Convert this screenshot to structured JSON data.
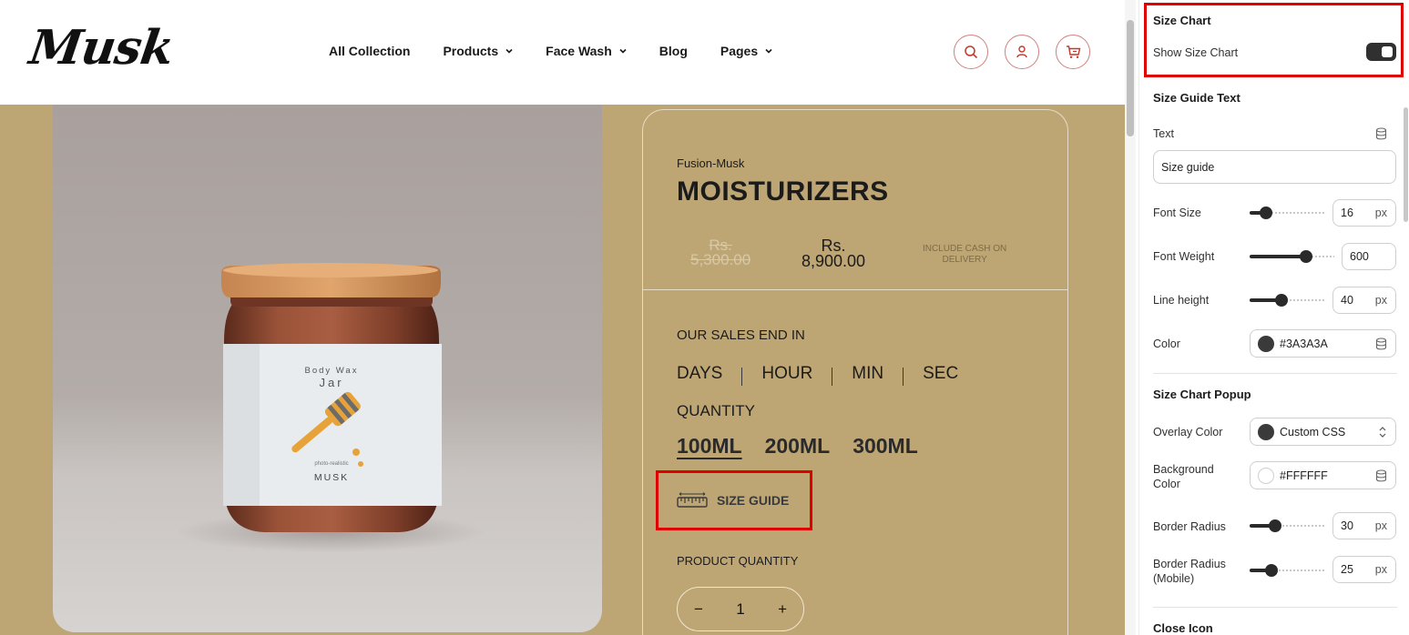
{
  "header": {
    "logo": "Musk",
    "nav": [
      {
        "label": "All Collection",
        "dropdown": false
      },
      {
        "label": "Products",
        "dropdown": true
      },
      {
        "label": "Face Wash",
        "dropdown": true
      },
      {
        "label": "Blog",
        "dropdown": false
      },
      {
        "label": "Pages",
        "dropdown": true
      }
    ],
    "icons": [
      "search-icon",
      "user-icon",
      "cart-icon"
    ],
    "icon_color": "#c0392b"
  },
  "product": {
    "image_label": {
      "line1": "Body Wax",
      "line2": "Jar",
      "line3": "photo-realistic",
      "brand": "MUSK"
    },
    "vendor": "Fusion-Musk",
    "title": "MOISTURIZERS",
    "old_price_currency": "Rs.",
    "old_price_amount": "5,300.00",
    "new_price_currency": "Rs.",
    "new_price_amount": "8,900.00",
    "cod_note_line1": "INCLUDE CASH ON",
    "cod_note_line2": "DELIVERY",
    "sales_end_label": "OUR SALES END IN",
    "countdown": [
      "DAYS",
      "HOUR",
      "MIN",
      "SEC"
    ],
    "quantity_label": "QUANTITY",
    "variants": [
      "100ML",
      "200ML",
      "300ML"
    ],
    "selected_variant": "100ML",
    "size_guide_label": "SIZE GUIDE",
    "product_quantity_label": "PRODUCT QUANTITY",
    "stepper": {
      "minus": "−",
      "value": "1",
      "plus": "+"
    },
    "background_color": "#bea674"
  },
  "panel": {
    "size_chart": {
      "heading": "Size Chart",
      "show_label": "Show Size Chart",
      "show_enabled": true
    },
    "size_guide_text": {
      "heading": "Size Guide Text",
      "text_label": "Text",
      "text_value": "Size guide",
      "font_size_label": "Font Size",
      "font_size_value": "16",
      "font_size_level": 0.22,
      "font_weight_label": "Font Weight",
      "font_weight_value": "600",
      "font_weight_level": 0.67,
      "line_height_label": "Line height",
      "line_height_value": "40",
      "line_height_level": 0.42,
      "color_label": "Color",
      "color_value": "#3A3A3A",
      "unit": "px"
    },
    "size_chart_popup": {
      "heading": "Size Chart Popup",
      "overlay_label": "Overlay Color",
      "overlay_value": "Custom CSS",
      "overlay_swatch": "#3a3a3a",
      "bg_label_line1": "Background",
      "bg_label_line2": "Color",
      "bg_value": "#FFFFFF",
      "radius_label": "Border Radius",
      "radius_value": "30",
      "radius_level": 0.33,
      "radius_mobile_label_line1": "Border Radius",
      "radius_mobile_label_line2": "(Mobile)",
      "radius_mobile_value": "25",
      "radius_mobile_level": 0.29,
      "unit": "px"
    },
    "close_icon_heading": "Close Icon"
  }
}
